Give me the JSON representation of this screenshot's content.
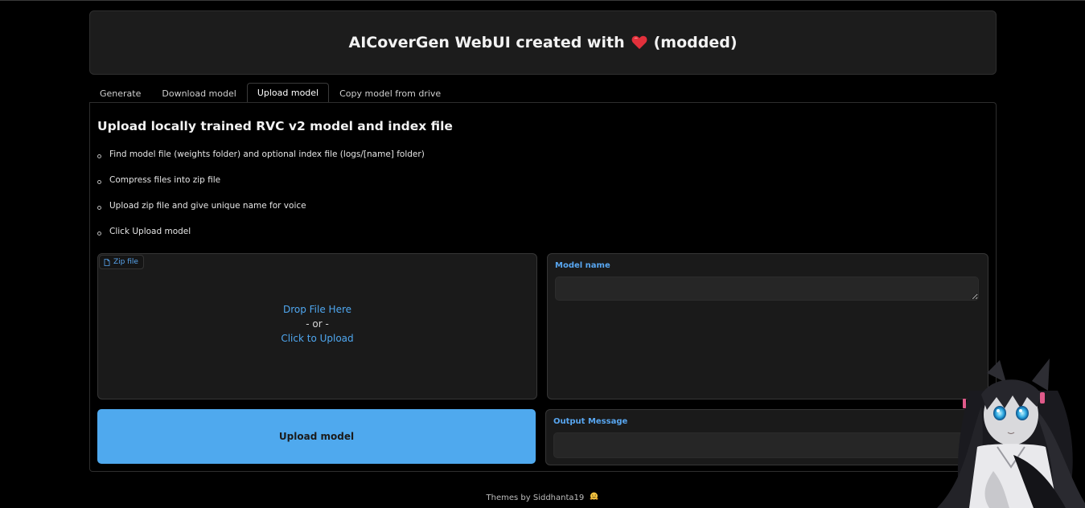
{
  "header": {
    "title_prefix": "AICoverGen WebUI created with",
    "title_suffix": "(modded)"
  },
  "tabs": [
    {
      "label": "Generate"
    },
    {
      "label": "Download model"
    },
    {
      "label": "Upload model",
      "active": true
    },
    {
      "label": "Copy model from drive"
    }
  ],
  "upload_tab": {
    "title": "Upload locally trained RVC v2 model and index file",
    "steps": [
      "Find model file (weights folder) and optional index file (logs/[name] folder)",
      "Compress files into zip file",
      "Upload zip file and give unique name for voice",
      "Click Upload model"
    ],
    "zip_file": {
      "label": "Zip file",
      "drop_text": "Drop File Here",
      "or_text": "- or -",
      "click_text": "Click to Upload"
    },
    "model_name": {
      "label": "Model name",
      "value": ""
    },
    "upload_button": "Upload model",
    "output": {
      "label": "Output Message",
      "value": ""
    }
  },
  "footer": {
    "text": "Themes by Siddhanta19"
  },
  "icons": {
    "heart": "heart-icon",
    "file": "file-icon",
    "footer_emoji": "hugging-face-icon"
  },
  "colors": {
    "accent": "#4fa9ee",
    "background": "#000000",
    "panel": "#1a1a1a"
  }
}
